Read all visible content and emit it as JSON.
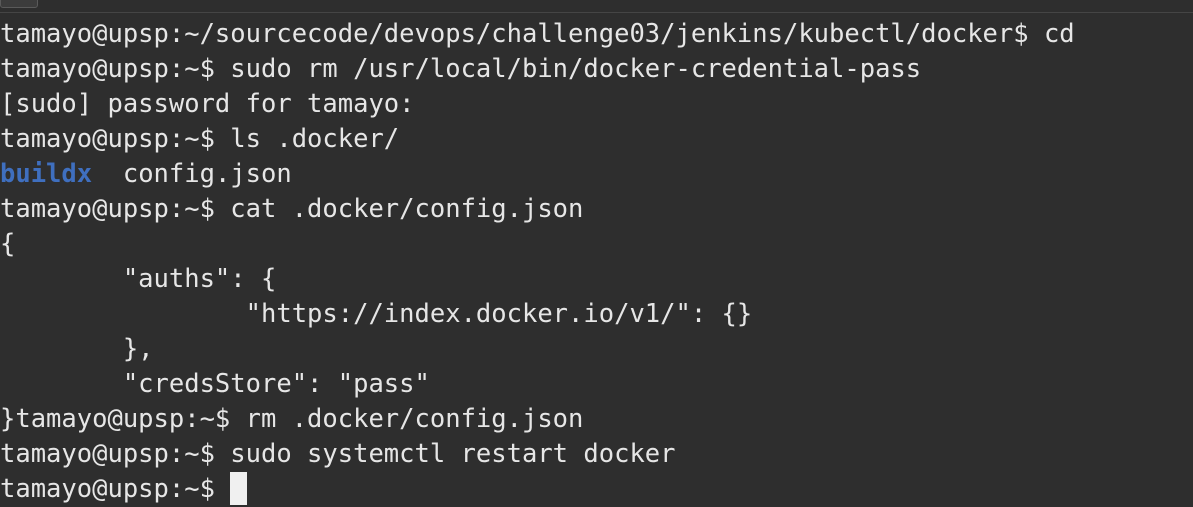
{
  "terminal": {
    "lines": [
      "tamayo@upsp:~/sourcecode/devops/challenge03/jenkins/kubectl/docker$ cd",
      "tamayo@upsp:~$ sudo rm /usr/local/bin/docker-credential-pass",
      "[sudo] password for tamayo:",
      "tamayo@upsp:~$ ls .docker/",
      "",
      "tamayo@upsp:~$ cat .docker/config.json",
      "{",
      "        \"auths\": {",
      "                \"https://index.docker.io/v1/\": {}",
      "        },",
      "        \"credsStore\": \"pass\"",
      "}tamayo@upsp:~$ rm .docker/config.json",
      "tamayo@upsp:~$ sudo systemctl restart docker",
      ""
    ],
    "ls_output": {
      "dir_entry": "buildx",
      "separator": "  ",
      "file_entry": "config.json"
    },
    "current_prompt": "tamayo@upsp:~$ ",
    "colors": {
      "background": "#2e2e2e",
      "foreground": "#e6e6e6",
      "directory": "#3f6fbf",
      "cursor": "#f0f0f0"
    }
  }
}
